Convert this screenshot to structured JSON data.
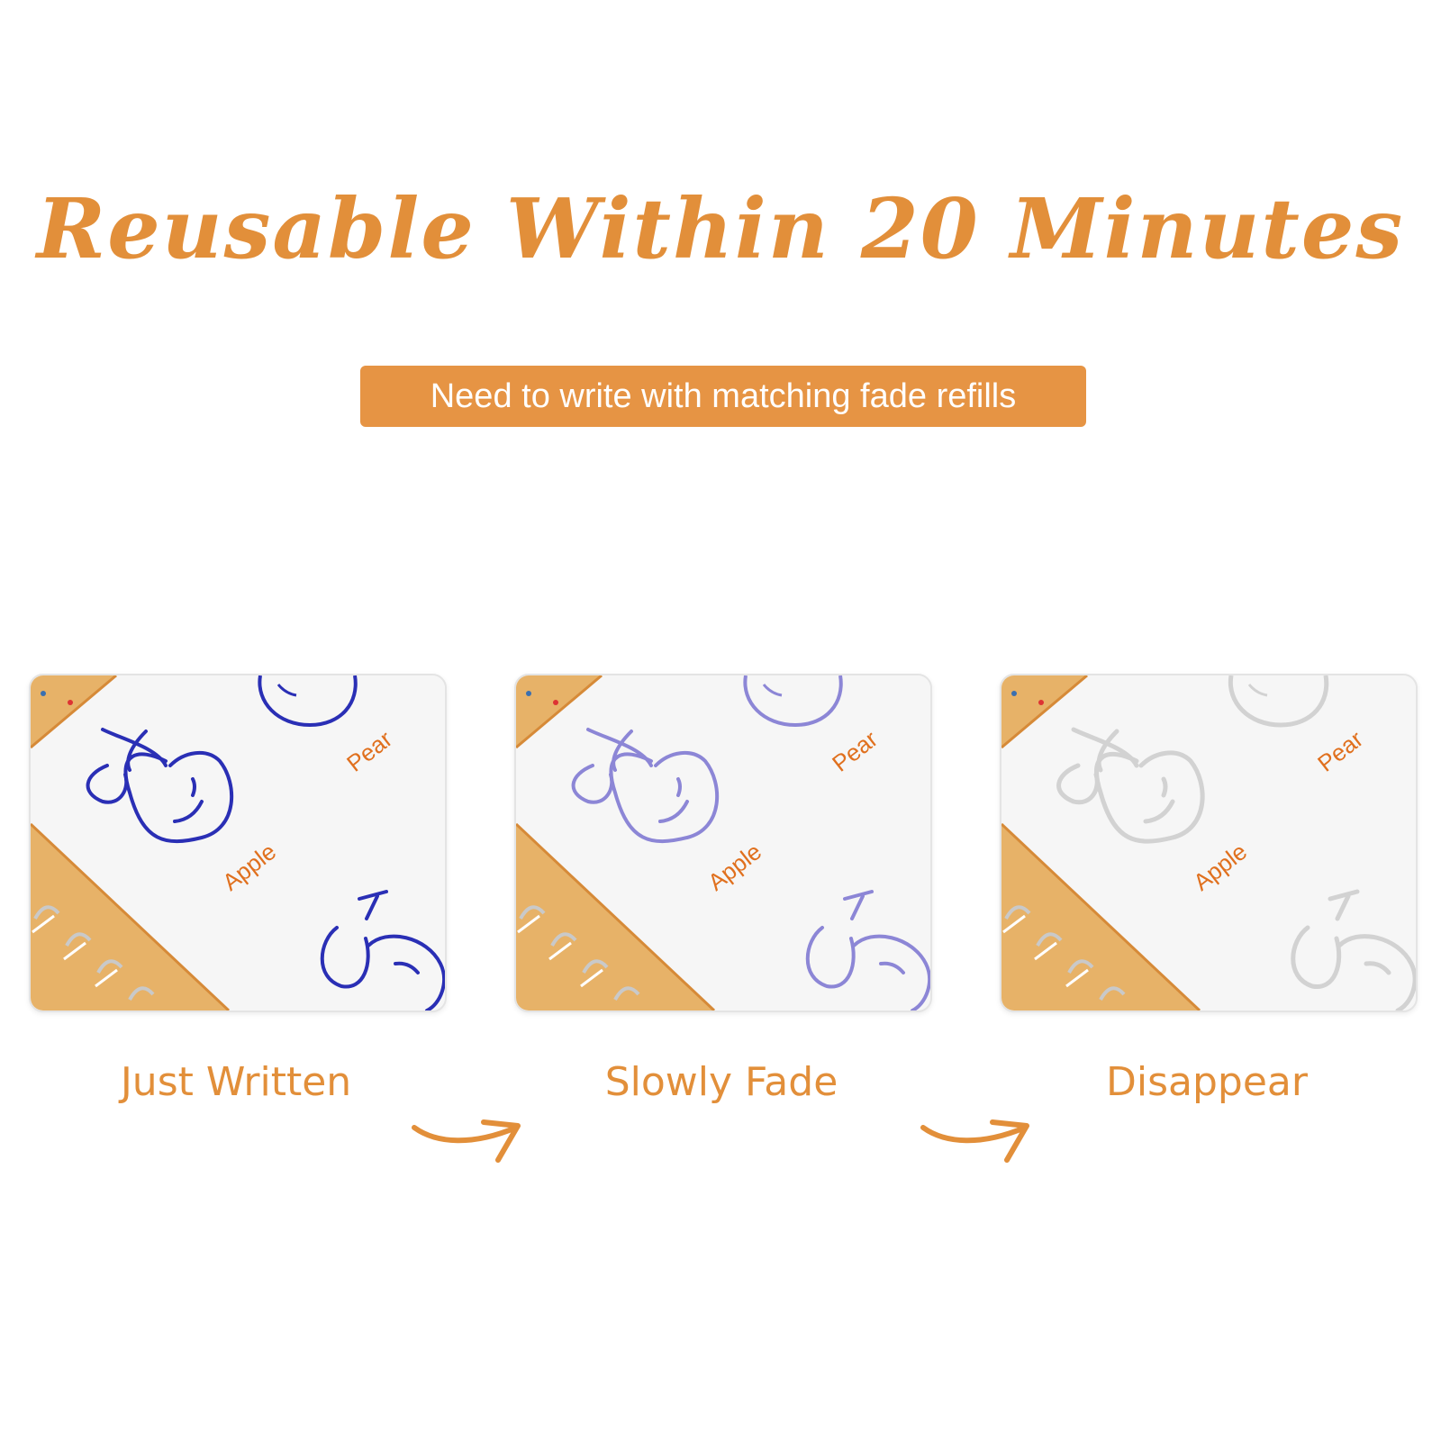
{
  "header": {
    "title": "Reusable Within 20 Minutes",
    "subtitle": "Need to write with matching fade refills"
  },
  "colors": {
    "accent": "#E28F3A",
    "pill": "#E69444",
    "ink_fresh": "#2A2FB5",
    "ink_fading": "#8C86D6",
    "ink_gone": "#D2D2D2",
    "word_label": "#E0701E"
  },
  "stages": [
    {
      "label": "Just Written",
      "word_apple": "Apple",
      "word_pear": "Pear"
    },
    {
      "label": "Slowly Fade",
      "word_apple": "Apple",
      "word_pear": "Pear"
    },
    {
      "label": "Disappear",
      "word_apple": "Apple",
      "word_pear": "Pear"
    }
  ],
  "icons": {
    "arrow": "curved-arrow-right-icon",
    "apple": "apple-drawing-icon",
    "pear": "pear-drawing-icon",
    "cherry": "cherry-drawing-icon"
  }
}
